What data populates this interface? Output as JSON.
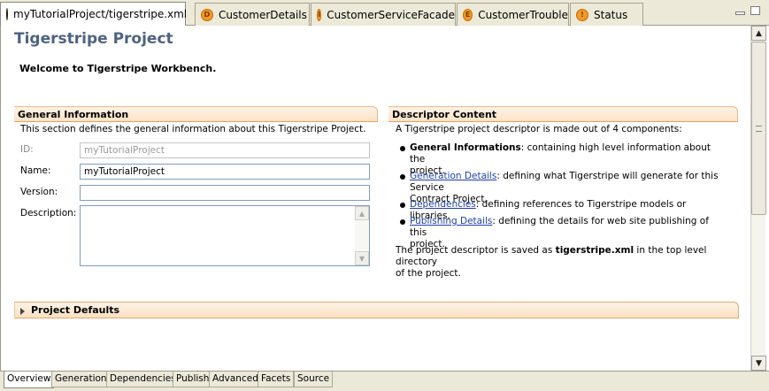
{
  "tabs": [
    {
      "label": "myTutorialProject/tigerstripe.xml",
      "icon": "project-icon",
      "active": true,
      "closable": true
    },
    {
      "label": "CustomerDetails",
      "icon_letter": "D"
    },
    {
      "label": "CustomerServiceFacade",
      "icon_letter": "I"
    },
    {
      "label": "CustomerTrouble",
      "icon_letter": "E"
    },
    {
      "label": "Status",
      "icon_letter": "!"
    }
  ],
  "tab_close_glyph": "✕",
  "page": {
    "title": "Tigerstripe Project",
    "welcome": "Welcome to Tigerstripe Workbench."
  },
  "general": {
    "heading": "General Information",
    "description": "This section defines the general information about this Tigerstripe Project.",
    "fields": {
      "id_label": "ID:",
      "id_value": "myTutorialProject",
      "name_label": "Name:",
      "name_value": "myTutorialProject",
      "version_label": "Version:",
      "version_value": "",
      "description_label": "Description:",
      "description_value": ""
    }
  },
  "descriptor": {
    "heading": "Descriptor Content",
    "intro": "A Tigerstripe project descriptor is made out of 4 components:",
    "items": [
      {
        "term": "General Informations",
        "is_link": false,
        "text": ": containing high level information about the",
        "text2": "project."
      },
      {
        "term": "Generation Details",
        "is_link": true,
        "text": ": defining what Tigerstripe will generate for this Service",
        "text2": "Contract Project."
      },
      {
        "term": "Dependencies",
        "is_link": true,
        "text": ": defining references to Tigerstripe models or libraries.",
        "text2": ""
      },
      {
        "term": "Publishing Details",
        "is_link": true,
        "text": ": defining the details for web site publishing of this",
        "text2": "project."
      }
    ],
    "footer_pre": "The project descriptor is saved as ",
    "footer_file": "tigerstripe.xml",
    "footer_post": " in the top level directory",
    "footer_line2": "of the project."
  },
  "project_defaults": {
    "label": "Project Defaults"
  },
  "bottom_tabs": [
    "Overview",
    "Generation",
    "Dependencies",
    "Publish",
    "Advanced",
    "Facets",
    "Source"
  ],
  "colors": {
    "title": "#4d6380",
    "link": "#1e3ea8",
    "section_border": "#e8a060"
  }
}
